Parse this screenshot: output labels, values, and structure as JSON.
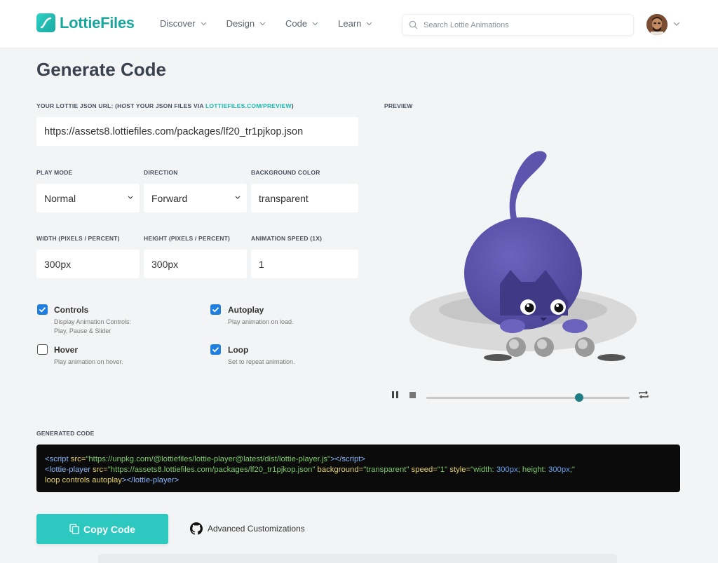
{
  "header": {
    "logo_text": "LottieFiles",
    "nav": [
      {
        "label": "Discover"
      },
      {
        "label": "Design"
      },
      {
        "label": "Code"
      },
      {
        "label": "Learn"
      }
    ],
    "search_placeholder": "Search Lottie Animations"
  },
  "page_title": "Generate Code",
  "json_url": {
    "label_prefix": "YOUR LOTTIE JSON URL: (HOST YOUR JSON FILES VIA ",
    "label_link": "LOTTIEFILES.COM/PREVIEW",
    "label_suffix": ")",
    "value": "https://assets8.lottiefiles.com/packages/lf20_tr1pjkop.json"
  },
  "play_mode": {
    "label": "PLAY MODE",
    "value": "Normal"
  },
  "direction": {
    "label": "DIRECTION",
    "value": "Forward"
  },
  "background_color": {
    "label": "BACKGROUND COLOR",
    "value": "transparent"
  },
  "width": {
    "label": "WIDTH (PIXELS / PERCENT)",
    "value": "300px"
  },
  "height": {
    "label": "HEIGHT (PIXELS / PERCENT)",
    "value": "300px"
  },
  "speed": {
    "label": "ANIMATION SPEED (1X)",
    "value": "1"
  },
  "options": {
    "controls": {
      "title": "Controls",
      "desc1": "Display Animation Controls:",
      "desc2": "Play, Pause & Slider",
      "checked": true
    },
    "autoplay": {
      "title": "Autoplay",
      "desc1": "Play animation on load.",
      "checked": true
    },
    "hover": {
      "title": "Hover",
      "desc1": "Play animation on hover.",
      "checked": false
    },
    "loop": {
      "title": "Loop",
      "desc1": "Set to repeat animation.",
      "checked": true
    }
  },
  "preview": {
    "label": "PREVIEW",
    "progress": 0.75
  },
  "generated_code": {
    "label": "GENERATED CODE",
    "l1": {
      "t1": "<script",
      "a1": " src=",
      "s1": "\"https://unpkg.com/@lottiefiles/lottie-player@latest/dist/lottie-player.js\"",
      "t2": "></",
      "t3": "script>"
    },
    "l2": {
      "t1": "<lottie-player",
      "a1": " src=",
      "s1": "\"https://assets8.lottiefiles.com/packages/lf20_tr1pjkop.json\"",
      "a2": "  background=",
      "s2": "\"transparent\"",
      "a3": "  speed=",
      "s3": "\"1\"",
      "a4": "  style=",
      "s4a": "\"width: ",
      "n1": "300px",
      "s4b": "; height: ",
      "n2": "300px",
      "s4c": ";\""
    },
    "l3": {
      "p1": "loop controls autoplay",
      "t1": "></",
      "t2": "lottie-player>"
    }
  },
  "copy_button": "Copy Code",
  "advanced_link": "Advanced Customizations",
  "colors": {
    "accent": "#2dc9c1",
    "checkbox": "#1f7fe0",
    "cat": "#5a52a8"
  }
}
